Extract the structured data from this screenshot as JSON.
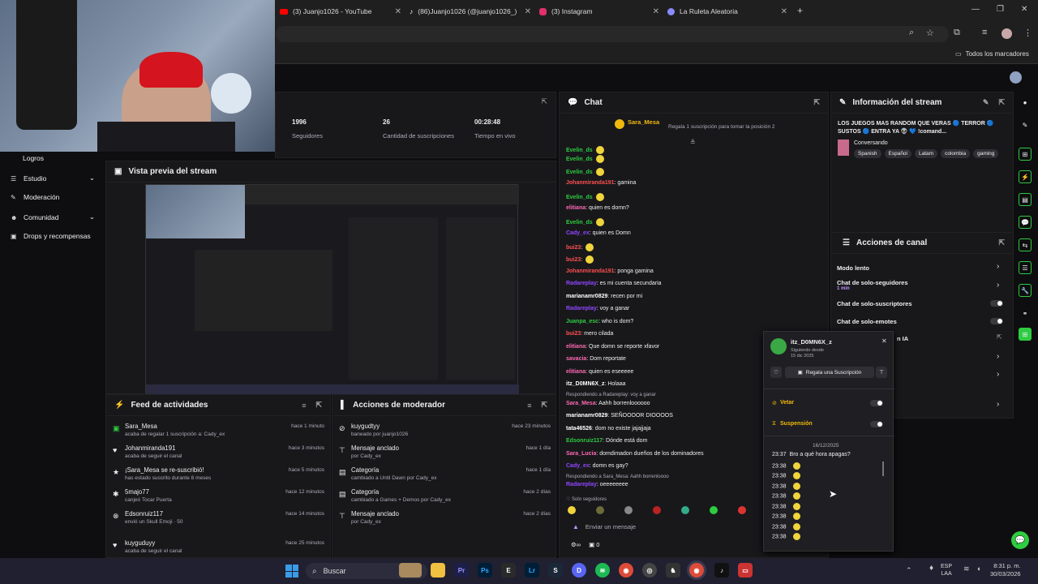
{
  "browser": {
    "tabs": [
      {
        "label": "(3) Juanjo1026 - YouTube",
        "icon": "youtube-icon"
      },
      {
        "label": "(86)Juanjo1026 (@juanjo1026_)",
        "icon": "tiktok-icon"
      },
      {
        "label": "(3) Instagram",
        "icon": "instagram-icon"
      },
      {
        "label": "La Ruleta Aleatoria",
        "icon": "globe-icon"
      }
    ],
    "bookmarks_label": "Todos los marcadores"
  },
  "sidebar": {
    "items": [
      {
        "label": "Logros"
      },
      {
        "label": "Estudio"
      },
      {
        "label": "Moderación"
      },
      {
        "label": "Comunidad"
      },
      {
        "label": "Drops y recompensas"
      }
    ]
  },
  "stats": [
    {
      "value": "1996",
      "label": "Seguidores"
    },
    {
      "value": "26",
      "label": "Cantidad de suscripciones"
    },
    {
      "value": "00:28:48",
      "label": "Tiempo en vivo"
    }
  ],
  "preview": {
    "title": "Vista previa del stream"
  },
  "feed": {
    "title": "Feed de actividades",
    "rows": [
      {
        "user": "Sara_Mesa",
        "sub": "acaba de regalar 1 suscripción a: Cady_ex",
        "time": "hace 1 minuto"
      },
      {
        "user": "Johanmiranda191",
        "sub": "acaba de seguir el canal",
        "time": "hace 3 minutos"
      },
      {
        "user": "¡Sara_Mesa se re-suscribió!",
        "sub": "has estado suscrito durante 8 meses",
        "time": "hace 5 minutos"
      },
      {
        "user": "5majo77",
        "sub": "canjeó Tocar Puerta",
        "time": "hace 12 minutos"
      },
      {
        "user": "Edsonruiz117",
        "sub": "envió un Skull Emoji · 50",
        "time": "hace 14 minutos"
      },
      {
        "user": "kuyguduyy",
        "sub": "acaba de seguir el canal",
        "time": "hace 25 minutos"
      }
    ]
  },
  "modactions": {
    "title": "Acciones de moderador",
    "rows": [
      {
        "title": "kuygudtyy",
        "sub": "baneado por juanjo1026",
        "time": "hace 23 minutos"
      },
      {
        "title": "Mensaje anclado",
        "sub": "por Cady_ex",
        "time": "hace 1 día"
      },
      {
        "title": "Categoría",
        "sub": "cambiado a Until Dawn por Cady_ex",
        "time": "hace 1 día"
      },
      {
        "title": "Categoría",
        "sub": "cambiado a Games + Demos por Cady_ex",
        "time": "hace 2 días"
      },
      {
        "title": "Mensaje anclado",
        "sub": "por Cady_ex",
        "time": "hace 2 días"
      }
    ]
  },
  "chat": {
    "title": "Chat",
    "pinned_user": "Sara_Mesa",
    "pinned_text": "Regala 1 suscripción para tomar la posición 2",
    "lines": [
      {
        "user": "Evelin_ds",
        "text": "",
        "color": "#2ecc40"
      },
      {
        "user": "Evelin_ds",
        "text": "",
        "color": "#2ecc40"
      },
      {
        "user": "Evelin_ds",
        "text": "",
        "color": "#2ecc40"
      },
      {
        "user": "Johanmiranda191",
        "text": ": gamina",
        "color": "#ff4f4f"
      },
      {
        "user": "Evelin_ds",
        "text": "",
        "color": "#2ecc40"
      },
      {
        "user": "elitiana",
        "text": ": quien es domn?",
        "color": "#ff69b4"
      },
      {
        "user": "Evelin_ds",
        "text": "",
        "color": "#2ecc40"
      },
      {
        "user": "Cady_ex",
        "text": ": quien es Domn",
        "color": "#9146ff"
      },
      {
        "user": "bui23",
        "text": ":",
        "color": "#ff4f4f"
      },
      {
        "user": "bui23",
        "text": ":",
        "color": "#ff4f4f"
      },
      {
        "user": "Johanmiranda191",
        "text": ": ponga gamina",
        "color": "#ff4f4f"
      },
      {
        "user": "Radareplay",
        "text": ": es mi cuenta secundaria",
        "color": "#9146ff"
      },
      {
        "user": "marianamr0829",
        "text": ": recen por mi",
        "color": "#ffffff"
      },
      {
        "user": "Radareplay",
        "text": ": voy a ganar",
        "color": "#9146ff"
      },
      {
        "user": "Juanpa_esc",
        "text": ": who is dom?",
        "color": "#2ecc40"
      },
      {
        "user": "bui23",
        "text": ": mero cilada",
        "color": "#ff4f4f"
      },
      {
        "user": "elitiana",
        "text": ": Que domn se reporte xfavor",
        "color": "#ff69b4"
      },
      {
        "user": "savacia",
        "text": ": Dom reportate",
        "color": "#ff69b4"
      },
      {
        "user": "elitiana",
        "text": ": quien es eseeeee",
        "color": "#ff69b4"
      },
      {
        "user": "itz_D0MN6X_z",
        "text": ": Holaaa",
        "color": "#ffffff"
      }
    ],
    "reply1": "Respondiendo a Radareplay: voy a ganar",
    "lines2": [
      {
        "user": "Sara_Mesa",
        "text": ": Aahh borrenloooooo",
        "color": "#ff69b4"
      },
      {
        "user": "marianamr0829",
        "text": ": SEÑOOOOR DIOOOOS",
        "color": "#ffffff"
      },
      {
        "user": "tata46526",
        "text": ": dom no existe jajajjaja",
        "color": "#ffffff"
      },
      {
        "user": "Edsonruiz117",
        "text": ": Dónde está dom",
        "color": "#2ecc40"
      },
      {
        "user": "Sara_Lucia",
        "text": ": domdimadon dueños de los dominadores",
        "color": "#ff69b4"
      },
      {
        "user": "Cady_ex",
        "text": ": domn es gay?",
        "color": "#9146ff"
      }
    ],
    "reply2": "Respondiendo a Sara_Mesa: Aahh borrenloooo",
    "last": {
      "user": "Radareplay",
      "text": ": oeeeeeeee",
      "color": "#9146ff"
    },
    "followers_only": "Solo seguidores",
    "input_placeholder": "Enviar un mensaje",
    "points": "0"
  },
  "usercard": {
    "name": "itz_D0MN6X_z",
    "following": "Siguiendo desde",
    "date": "15 dic 2025",
    "gift": "Regala una Suscripción",
    "veto": "Vetar",
    "suspension": "Suspensión",
    "log_date": "16/12/2025",
    "log": [
      {
        "time": "23:37",
        "text": "Bro a qué hora apagas?"
      },
      {
        "time": "23:38",
        "text": ""
      },
      {
        "time": "23:38",
        "text": ""
      },
      {
        "time": "23:38",
        "text": ""
      },
      {
        "time": "23:38",
        "text": ""
      },
      {
        "time": "23:38",
        "text": ""
      },
      {
        "time": "23:38",
        "text": ""
      },
      {
        "time": "23:38",
        "text": ""
      },
      {
        "time": "23:38",
        "text": ""
      }
    ]
  },
  "streaminfo": {
    "title": "Información del stream",
    "stream_title": "LOS JUEGOS MAS RANDOM QUE VERAS 🔵 TERROR 🔵 SUSTOS 🔵 ENTRA YA 👽 💙 !comand...",
    "category": "Conversando",
    "tags": [
      "Spanish",
      "Español",
      "Latam",
      "colombia",
      "gaming"
    ]
  },
  "channelactions": {
    "title": "Acciones de canal",
    "slow": "Modo lento",
    "followers": "Chat de solo-seguidores",
    "followers_sub": "1 min",
    "subs": "Chat de solo-suscriptores",
    "emotes": "Chat de solo-emotes",
    "ia": "n IA"
  },
  "taskbar": {
    "search": "Buscar",
    "lang": "ESP",
    "lang2": "LAA",
    "time": "8:31 p. m.",
    "date": "30/03/2026"
  }
}
